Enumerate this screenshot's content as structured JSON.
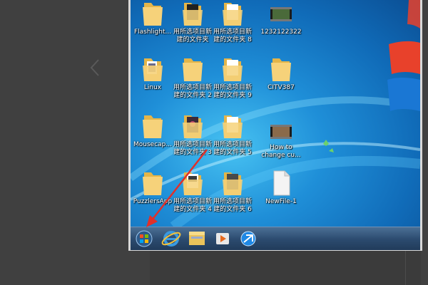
{
  "desktop": {
    "icons": [
      {
        "label": "Flashlight...",
        "type": "folder"
      },
      {
        "label": "用所选项目新\n建的文件夹",
        "type": "folder-dark"
      },
      {
        "label": "用所选项目新\n建的文件夹 8",
        "type": "folder-doc"
      },
      {
        "label": "1232122322",
        "type": "video"
      },
      {
        "label": "Linux",
        "type": "folder-doc"
      },
      {
        "label": "用所选项目新\n建的文件夹 2",
        "type": "folder"
      },
      {
        "label": "用所选项目新\n建的文件夹 9",
        "type": "folder-doc"
      },
      {
        "label": "CITV387",
        "type": "folder"
      },
      {
        "label": "Mousecap...",
        "type": "folder"
      },
      {
        "label": "用所选项目新\n建的文件夹 3",
        "type": "folder-dark"
      },
      {
        "label": "用所选项目新\n建的文件夹 5",
        "type": "folder-doc"
      },
      {
        "label": "How to\nchange cu...",
        "type": "video"
      },
      {
        "label": "PuzzlersApp",
        "type": "folder"
      },
      {
        "label": "用所选项目新\n建的文件夹 4",
        "type": "folder-doc"
      },
      {
        "label": "用所选项目新\n建的文件夹 6",
        "type": "folder-dark"
      },
      {
        "label": "NewFile-1",
        "type": "file"
      }
    ]
  },
  "taskbar": {
    "buttons": [
      "start-orb",
      "internet-explorer",
      "windows-explorer",
      "media-player",
      "network-app"
    ]
  },
  "colors": {
    "desktop": "#1f8fd8",
    "taskbar": "#2b4a6e",
    "annotation_arrow": "#e0302a"
  }
}
